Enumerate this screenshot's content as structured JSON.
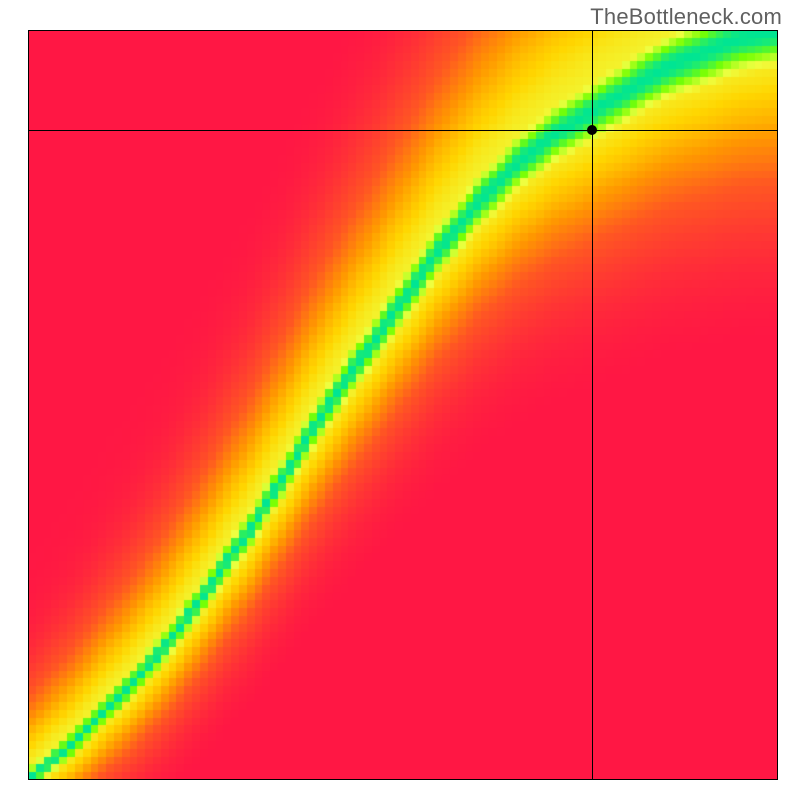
{
  "watermark": "TheBottleneck.com",
  "chart_data": {
    "type": "heatmap",
    "title": "",
    "xlabel": "",
    "ylabel": "",
    "xlim": [
      0,
      1
    ],
    "ylim": [
      0,
      1
    ],
    "grid": false,
    "legend": "none",
    "crosshair": {
      "x_fraction": 0.752,
      "y_fraction_from_top": 0.133
    },
    "marker": {
      "x_fraction": 0.752,
      "y_fraction_from_top": 0.133,
      "shape": "circle",
      "color": "#000000"
    },
    "field_description": "Compatibility/bottleneck score over a 2D parameter grid. A narrow high-score (green) band runs roughly along the diagonal with an S-curve shape; score falls off toward red on either side.",
    "ridge_curve_points": [
      {
        "x": 0.0,
        "y": 0.0
      },
      {
        "x": 0.05,
        "y": 0.04
      },
      {
        "x": 0.1,
        "y": 0.09
      },
      {
        "x": 0.15,
        "y": 0.14
      },
      {
        "x": 0.2,
        "y": 0.2
      },
      {
        "x": 0.25,
        "y": 0.27
      },
      {
        "x": 0.3,
        "y": 0.34
      },
      {
        "x": 0.35,
        "y": 0.42
      },
      {
        "x": 0.4,
        "y": 0.5
      },
      {
        "x": 0.45,
        "y": 0.57
      },
      {
        "x": 0.5,
        "y": 0.64
      },
      {
        "x": 0.55,
        "y": 0.71
      },
      {
        "x": 0.6,
        "y": 0.77
      },
      {
        "x": 0.65,
        "y": 0.82
      },
      {
        "x": 0.7,
        "y": 0.86
      },
      {
        "x": 0.75,
        "y": 0.89
      },
      {
        "x": 0.8,
        "y": 0.92
      },
      {
        "x": 0.85,
        "y": 0.95
      },
      {
        "x": 0.9,
        "y": 0.97
      },
      {
        "x": 0.95,
        "y": 0.99
      },
      {
        "x": 1.0,
        "y": 1.0
      }
    ],
    "band_half_width_fraction": 0.045,
    "colorscale": [
      {
        "t": 0.0,
        "color": "#ff1744"
      },
      {
        "t": 0.35,
        "color": "#ff5722"
      },
      {
        "t": 0.55,
        "color": "#ff9800"
      },
      {
        "t": 0.72,
        "color": "#ffd600"
      },
      {
        "t": 0.85,
        "color": "#eeff41"
      },
      {
        "t": 0.93,
        "color": "#76ff03"
      },
      {
        "t": 1.0,
        "color": "#00e593"
      }
    ],
    "resolution_hint": 96
  }
}
